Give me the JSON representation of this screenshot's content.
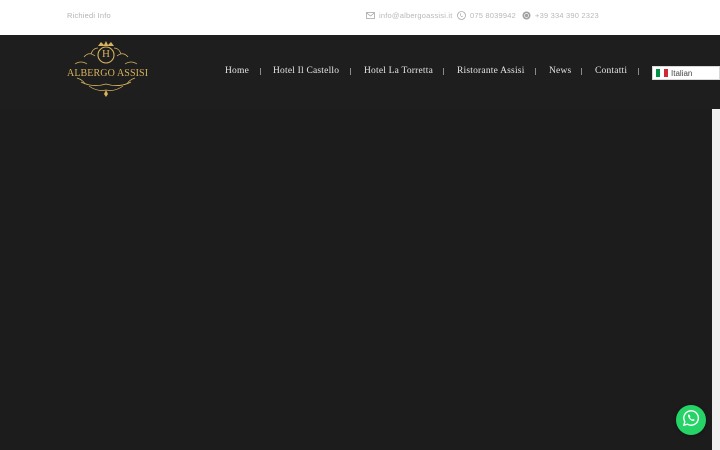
{
  "topbar": {
    "request_info": "Richiedi Info",
    "email": "info@albergoassisi.it",
    "phone": "075 8039942",
    "whatsapp": "+39 334 390 2323"
  },
  "brand": {
    "logo_letter": "H",
    "logo_name": "ALBERGO ASSISI",
    "gold": "#d8b45e"
  },
  "nav": {
    "items": [
      {
        "label": "Home"
      },
      {
        "label": "Hotel Il Castello"
      },
      {
        "label": "Hotel La Torretta"
      },
      {
        "label": "Ristorante Assisi"
      },
      {
        "label": "News"
      },
      {
        "label": "Contatti"
      }
    ]
  },
  "language": {
    "selected": "Italian",
    "flag_colors": [
      "#009246",
      "#ffffff",
      "#ce2b37"
    ]
  },
  "colors": {
    "header_bg": "#1e1e1e",
    "page_bg": "#1c1c1c",
    "whatsapp_green": "#25d366"
  }
}
